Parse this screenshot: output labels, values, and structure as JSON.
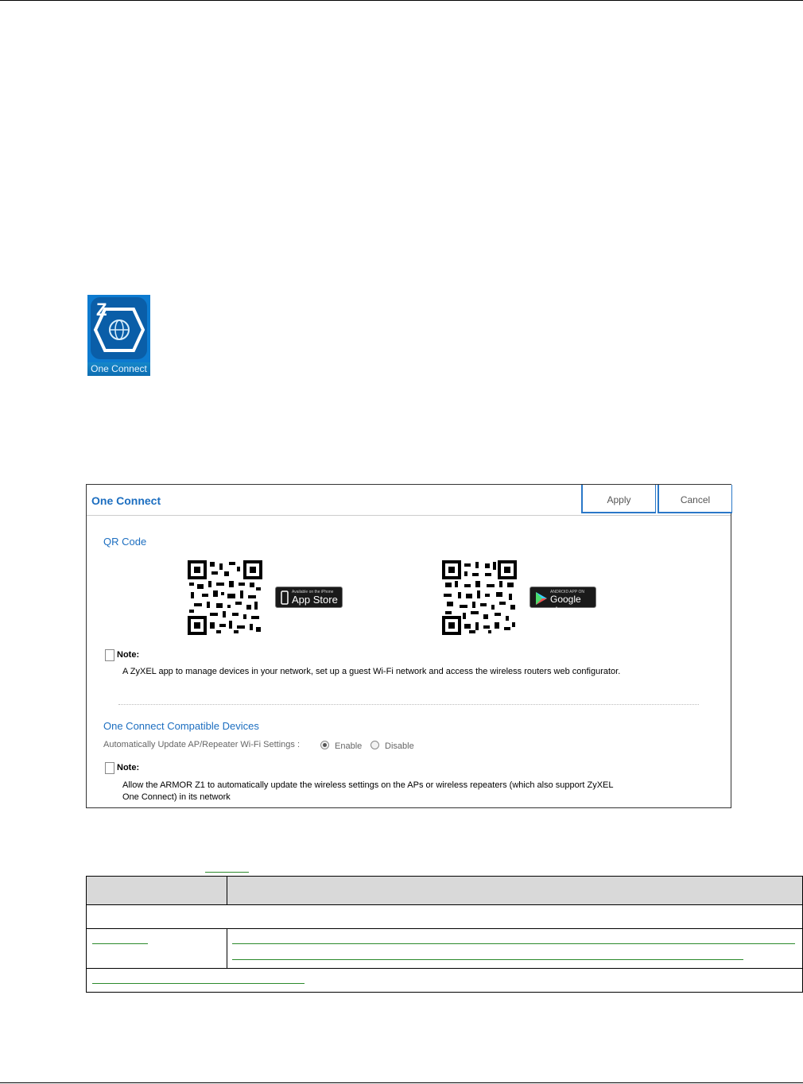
{
  "app_icon": {
    "label": "One Connect"
  },
  "panel": {
    "title": "One Connect",
    "apply_label": "Apply",
    "cancel_label": "Cancel",
    "qr_section_title": "QR Code",
    "app_store": {
      "small": "Available on the iPhone",
      "big": "App Store"
    },
    "google_play": {
      "small": "ANDROID APP ON",
      "big": "Google play"
    },
    "note_label": "Note:",
    "note1": "A ZyXEL app to manage devices in your network, set up a guest Wi-Fi network and access the wireless routers web configurator.",
    "compat_title": "One Connect Compatible Devices",
    "auto_update_label": "Automatically Update AP/Repeater Wi-Fi Settings :",
    "enable_label": "Enable",
    "disable_label": "Disable",
    "note2_line1": "Allow the ARMOR Z1 to automatically update the wireless settings on the APs or wireless repeaters (which also support ZyXEL",
    "note2_line2": "One Connect) in its network"
  }
}
